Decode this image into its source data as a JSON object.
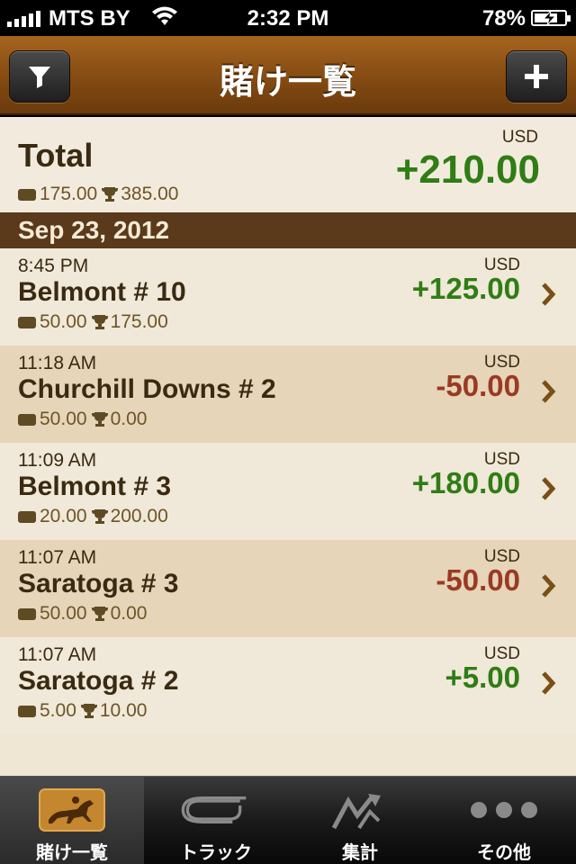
{
  "status_bar": {
    "carrier": "MTS BY",
    "time": "2:32 PM",
    "battery_percent": "78%",
    "battery_level": 0.78,
    "icons": [
      "signal-icon",
      "wifi-icon",
      "battery-charging-icon"
    ]
  },
  "nav": {
    "title": "賭け一覧",
    "left_button_icon": "filter-icon",
    "right_button_icon": "plus-icon"
  },
  "total": {
    "label": "Total",
    "currency": "USD",
    "amount": "+210.00",
    "stake": "175.00",
    "winnings": "385.00"
  },
  "section": {
    "date": "Sep 23, 2012"
  },
  "bets": [
    {
      "time": "8:45 PM",
      "name": "Belmont # 10",
      "currency": "USD",
      "amount": "+125.00",
      "stake": "50.00",
      "winnings": "175.00",
      "result": "positive"
    },
    {
      "time": "11:18 AM",
      "name": "Churchill Downs # 2",
      "currency": "USD",
      "amount": "-50.00",
      "stake": "50.00",
      "winnings": "0.00",
      "result": "negative"
    },
    {
      "time": "11:09 AM",
      "name": "Belmont # 3",
      "currency": "USD",
      "amount": "+180.00",
      "stake": "20.00",
      "winnings": "200.00",
      "result": "positive"
    },
    {
      "time": "11:07 AM",
      "name": "Saratoga # 3",
      "currency": "USD",
      "amount": "-50.00",
      "stake": "50.00",
      "winnings": "0.00",
      "result": "negative"
    },
    {
      "time": "11:07 AM",
      "name": "Saratoga # 2",
      "currency": "USD",
      "amount": "+5.00",
      "stake": "5.00",
      "winnings": "10.00",
      "result": "positive"
    }
  ],
  "tabs": [
    {
      "label": "賭け一覧",
      "icon": "horse-racing-icon",
      "active": true
    },
    {
      "label": "トラック",
      "icon": "track-icon",
      "active": false
    },
    {
      "label": "集計",
      "icon": "chart-icon",
      "active": false
    },
    {
      "label": "その他",
      "icon": "more-icon",
      "active": false
    }
  ],
  "colors": {
    "positive": "#2f7d14",
    "negative": "#9a3a24",
    "nav_brown": "#8a4f14",
    "section_brown": "#5a3a1a",
    "text_dark": "#3a2a12"
  }
}
